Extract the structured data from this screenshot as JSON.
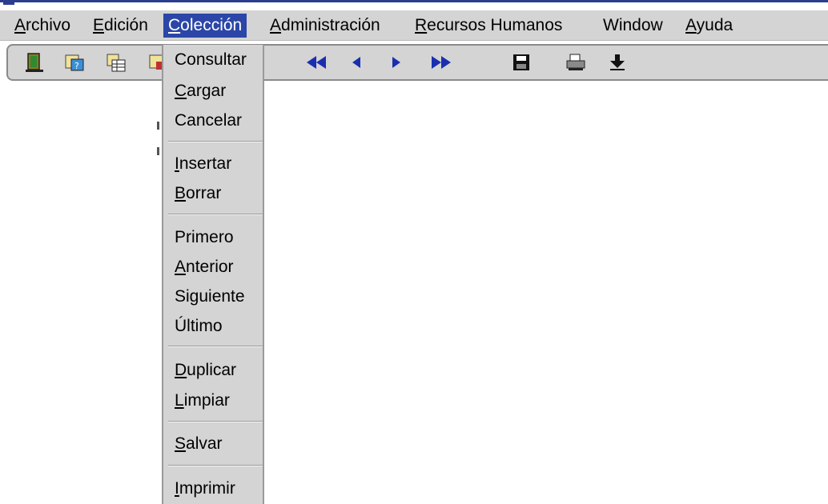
{
  "menubar": {
    "items": [
      {
        "label": "Archivo",
        "mnemonic": "A",
        "rest": "rchivo"
      },
      {
        "label": "Edición",
        "mnemonic": "E",
        "rest": "dición"
      },
      {
        "label": "Colección",
        "mnemonic": "C",
        "rest": "olección"
      },
      {
        "label": "Administración",
        "mnemonic": "A",
        "rest": "dministración"
      },
      {
        "label": "Recursos Humanos",
        "mnemonic": "R",
        "rest": "ecursos Humanos"
      },
      {
        "label": "Window",
        "mnemonic": "",
        "rest": "Window"
      },
      {
        "label": "Ayuda",
        "mnemonic": "A",
        "rest": "yuda"
      }
    ],
    "active": "Colección"
  },
  "toolbar": {
    "icons": [
      "exit-icon",
      "query-icon",
      "table-icon",
      "folder-icon",
      "first-record-icon",
      "previous-record-icon",
      "next-record-icon",
      "last-record-icon",
      "save-icon",
      "print-icon",
      "download-icon"
    ]
  },
  "dropdown": {
    "items": [
      {
        "pre": "",
        "mnemonic": "",
        "post": "Consultar"
      },
      {
        "pre": "",
        "mnemonic": "C",
        "post": "argar"
      },
      {
        "pre": "",
        "mnemonic": "",
        "post": "Cancelar"
      },
      {
        "pre": "",
        "mnemonic": "I",
        "post": "nsertar"
      },
      {
        "pre": "",
        "mnemonic": "B",
        "post": "orrar"
      },
      {
        "pre": "",
        "mnemonic": "",
        "post": "Primero"
      },
      {
        "pre": "",
        "mnemonic": "A",
        "post": "nterior"
      },
      {
        "pre": "",
        "mnemonic": "",
        "post": "Siguiente"
      },
      {
        "pre": "",
        "mnemonic": "",
        "post": "Último"
      },
      {
        "pre": "",
        "mnemonic": "D",
        "post": "uplicar"
      },
      {
        "pre": "",
        "mnemonic": "L",
        "post": "impiar"
      },
      {
        "pre": "",
        "mnemonic": "S",
        "post": "alvar"
      },
      {
        "pre": "",
        "mnemonic": "I",
        "post": "mprimir"
      }
    ]
  },
  "colors": {
    "accent": "#2b46a8",
    "menu_bg": "#d4d4d4",
    "nav_blue": "#1a2fb0"
  }
}
